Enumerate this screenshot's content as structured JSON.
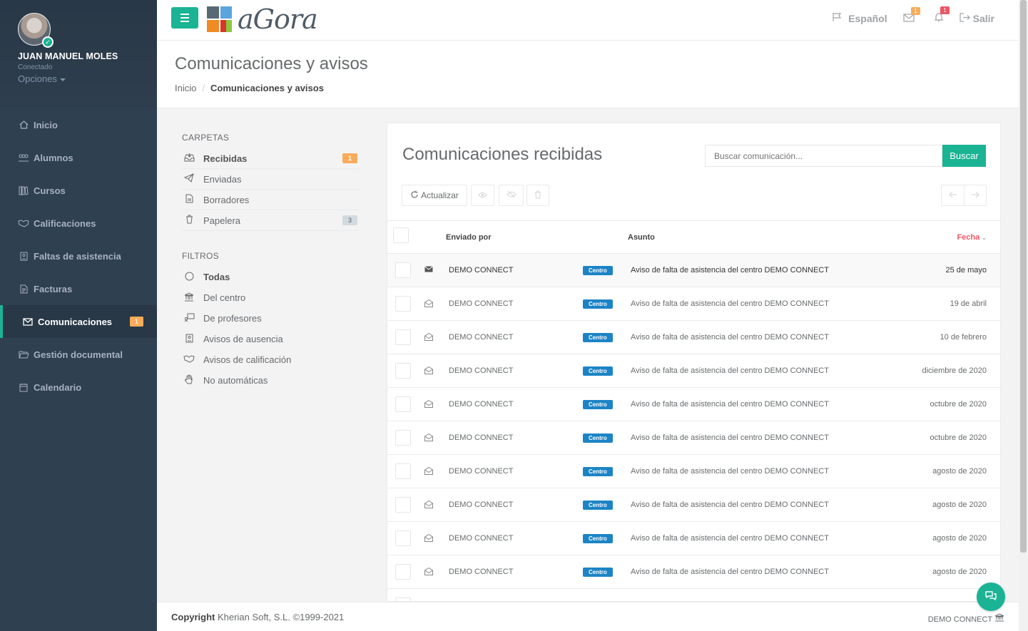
{
  "user": {
    "name": "JUAN MANUEL MOLES",
    "status": "Conectado",
    "options": "Opciones"
  },
  "nav": [
    {
      "label": "Inicio",
      "icon": "home-icon"
    },
    {
      "label": "Alumnos",
      "icon": "users-icon"
    },
    {
      "label": "Cursos",
      "icon": "books-icon"
    },
    {
      "label": "Calificaciones",
      "icon": "handshake-icon"
    },
    {
      "label": "Faltas de asistencia",
      "icon": "id-badge-icon"
    },
    {
      "label": "Facturas",
      "icon": "invoice-icon"
    },
    {
      "label": "Comunicaciones",
      "icon": "envelope-icon",
      "badge": "1",
      "active": true
    },
    {
      "label": "Gestión documental",
      "icon": "folder-open-icon"
    },
    {
      "label": "Calendario",
      "icon": "calendar-icon"
    }
  ],
  "topbar": {
    "logo_text": "aGora",
    "language": "Español",
    "messages_count": "1",
    "alerts_count": "1",
    "logout": "Salir"
  },
  "page": {
    "title": "Comunicaciones y avisos",
    "breadcrumb_home": "Inicio",
    "breadcrumb_current": "Comunicaciones y avisos"
  },
  "folders": {
    "heading": "CARPETAS",
    "items": [
      {
        "label": "Recibidas",
        "badge": "1"
      },
      {
        "label": "Enviadas"
      },
      {
        "label": "Borradores"
      },
      {
        "label": "Papelera",
        "badge": "3"
      }
    ]
  },
  "filters": {
    "heading": "FILTROS",
    "items": [
      {
        "label": "Todas"
      },
      {
        "label": "Del centro"
      },
      {
        "label": "De profesores"
      },
      {
        "label": "Avisos de ausencia"
      },
      {
        "label": "Avisos de calificación"
      },
      {
        "label": "No automáticas"
      }
    ]
  },
  "mailbox": {
    "title": "Comunicaciones recibidas",
    "search_placeholder": "Buscar comunicación...",
    "search_button": "Buscar",
    "refresh": "Actualizar",
    "col_sender": "Enviado por",
    "col_subject": "Asunto",
    "col_date": "Fecha",
    "rows": [
      {
        "sender": "DEMO CONNECT",
        "tag": "Centro",
        "subject": "Aviso de falta de asistencia del centro DEMO CONNECT",
        "date": "25 de mayo",
        "unread": true
      },
      {
        "sender": "DEMO CONNECT",
        "tag": "Centro",
        "subject": "Aviso de falta de asistencia del centro DEMO CONNECT",
        "date": "19 de abril"
      },
      {
        "sender": "DEMO CONNECT",
        "tag": "Centro",
        "subject": "Aviso de falta de asistencia del centro DEMO CONNECT",
        "date": "10 de febrero"
      },
      {
        "sender": "DEMO CONNECT",
        "tag": "Centro",
        "subject": "Aviso de falta de asistencia del centro DEMO CONNECT",
        "date": "diciembre de 2020"
      },
      {
        "sender": "DEMO CONNECT",
        "tag": "Centro",
        "subject": "Aviso de falta de asistencia del centro DEMO CONNECT",
        "date": "octubre de 2020"
      },
      {
        "sender": "DEMO CONNECT",
        "tag": "Centro",
        "subject": "Aviso de falta de asistencia del centro DEMO CONNECT",
        "date": "octubre de 2020"
      },
      {
        "sender": "DEMO CONNECT",
        "tag": "Centro",
        "subject": "Aviso de falta de asistencia del centro DEMO CONNECT",
        "date": "agosto de 2020"
      },
      {
        "sender": "DEMO CONNECT",
        "tag": "Centro",
        "subject": "Aviso de falta de asistencia del centro DEMO CONNECT",
        "date": "agosto de 2020"
      },
      {
        "sender": "DEMO CONNECT",
        "tag": "Centro",
        "subject": "Aviso de falta de asistencia del centro DEMO CONNECT",
        "date": "agosto de 2020"
      },
      {
        "sender": "DEMO CONNECT",
        "tag": "Centro",
        "subject": "Aviso de falta de asistencia del centro DEMO CONNECT",
        "date": "agosto de 2020"
      }
    ]
  },
  "footer": {
    "copyright_bold": "Copyright",
    "copyright_rest": " Kherian Soft, S.L. ©1999-2021",
    "center_name": "DEMO CONNECT"
  },
  "colors": {
    "primary": "#1ab394",
    "sidebar": "#2f4050",
    "badge_warning": "#f8ac59",
    "badge_danger": "#ed5565",
    "tag": "#1c84c6"
  }
}
